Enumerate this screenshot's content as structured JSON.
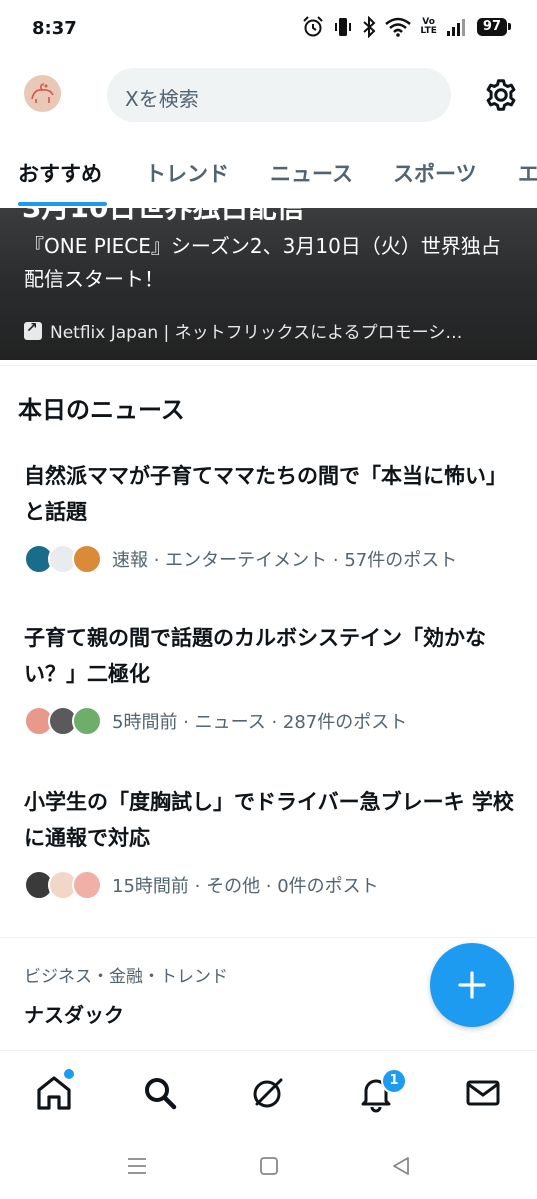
{
  "status_bar": {
    "time": "8:37",
    "battery": "97",
    "volte": "Vo\nLTE"
  },
  "header": {
    "search_placeholder": "Xを検索"
  },
  "tabs": [
    "おすすめ",
    "トレンド",
    "ニュース",
    "スポーツ",
    "エ"
  ],
  "hero": {
    "description": "『ONE PIECE』シーズン2、3月10日（火）世界独占配信スタート！",
    "source": "Netflix Japan | ネットフリックスによるプロモーシ…"
  },
  "section_title": "本日のニュース",
  "news": [
    {
      "title": "自然派ママが子育てママたちの間で「本当に怖い」と話題",
      "meta": "速報 · エンターテイメント · 57件のポスト"
    },
    {
      "title": "子育て親の間で話題のカルボシステイン「効かない？」二極化",
      "meta": "5時間前 · ニュース · 287件のポスト"
    },
    {
      "title": "小学生の「度胸試し」でドライバー急ブレーキ 学校に通報で対応",
      "meta": "15時間前 · その他 · 0件のポスト"
    }
  ],
  "trend": {
    "context": "ビジネス・金融・トレンド",
    "name": "ナスダック"
  },
  "notifications_badge": "1",
  "colors": {
    "accent": "#1d9bf0",
    "text": "#0f1419",
    "secondary": "#536471"
  },
  "icons": [
    "alarm-icon",
    "vibrate-icon",
    "bluetooth-icon",
    "wifi-icon",
    "signal-icon",
    "gear-icon",
    "home-icon",
    "search-icon",
    "grok-icon",
    "bell-icon",
    "mail-icon",
    "plus-icon"
  ]
}
